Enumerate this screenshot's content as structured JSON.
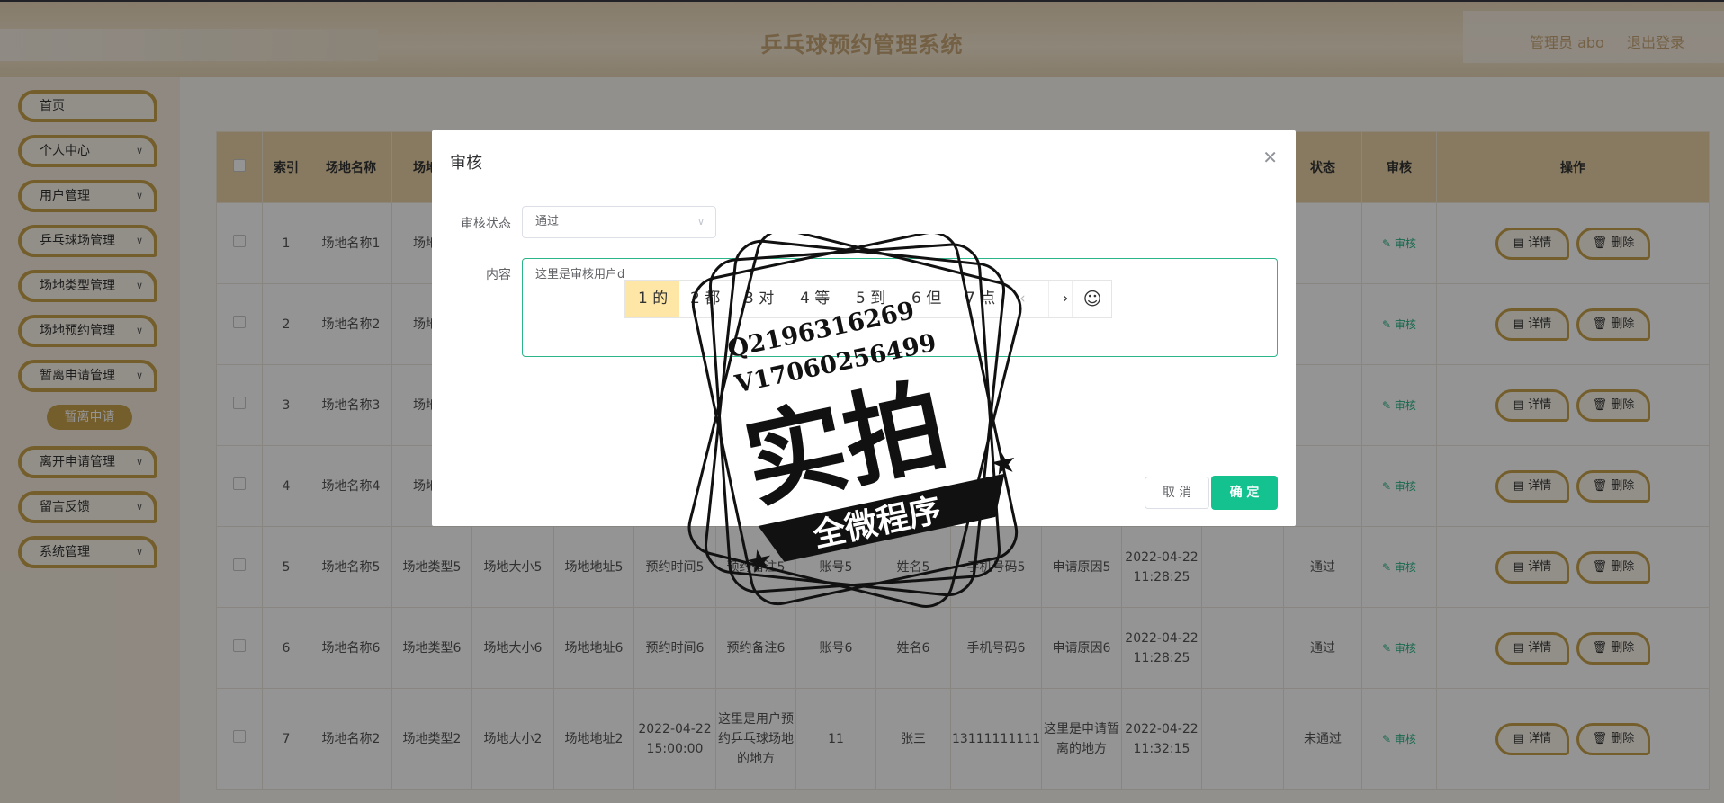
{
  "header": {
    "title": "乒乓球预约管理系统",
    "admin_label": "管理员 abo",
    "logout_label": "退出登录"
  },
  "sidebar": {
    "items": [
      {
        "label": "首页",
        "has_chevron": false
      },
      {
        "label": "个人中心",
        "has_chevron": true
      },
      {
        "label": "用户管理",
        "has_chevron": true
      },
      {
        "label": "乒乓球场管理",
        "has_chevron": true
      },
      {
        "label": "场地类型管理",
        "has_chevron": true
      },
      {
        "label": "场地预约管理",
        "has_chevron": true
      },
      {
        "label": "暂离申请管理",
        "has_chevron": true
      },
      {
        "label": "离开申请管理",
        "has_chevron": true
      },
      {
        "label": "留言反馈",
        "has_chevron": true
      },
      {
        "label": "系统管理",
        "has_chevron": true
      }
    ],
    "sub_item": "暂离申请",
    "chevron_icon": "chevron-down-icon"
  },
  "toolbar": {
    "delete_label": "删除"
  },
  "table": {
    "headers": {
      "index": "索引",
      "venue_name": "场地名称",
      "venue_type": "场地类",
      "status_tail": "状态",
      "audit": "审核",
      "ops": "操作"
    },
    "detail_label": "详情",
    "delete_label": "删除",
    "audit_label": "审核",
    "rows": [
      {
        "idx": "1",
        "name": "场地名称1",
        "type": "场地类",
        "size": "",
        "addr": "",
        "time": "",
        "note": "",
        "acct": "",
        "uname": "",
        "phone": "",
        "reason": "",
        "date": "",
        "result": ""
      },
      {
        "idx": "2",
        "name": "场地名称2",
        "type": "场地类",
        "size": "",
        "addr": "",
        "time": "",
        "note": "",
        "acct": "",
        "uname": "",
        "phone": "",
        "reason": "",
        "date": "",
        "result": ""
      },
      {
        "idx": "3",
        "name": "场地名称3",
        "type": "场地类",
        "size": "",
        "addr": "",
        "time": "",
        "note": "",
        "acct": "",
        "uname": "",
        "phone": "",
        "reason": "",
        "date": "",
        "result": ""
      },
      {
        "idx": "4",
        "name": "场地名称4",
        "type": "场地类",
        "size": "",
        "addr": "",
        "time": "",
        "note": "",
        "acct": "",
        "uname": "",
        "phone": "",
        "reason": "",
        "date": "",
        "result": ""
      },
      {
        "idx": "5",
        "name": "场地名称5",
        "type": "场地类型5",
        "size": "场地大小5",
        "addr": "场地地址5",
        "time": "预约时间5",
        "note": "预约备注5",
        "acct": "账号5",
        "uname": "姓名5",
        "phone": "手机号码5",
        "reason": "申请原因5",
        "date": "2022-04-22 11:28:25",
        "result": "通过"
      },
      {
        "idx": "6",
        "name": "场地名称6",
        "type": "场地类型6",
        "size": "场地大小6",
        "addr": "场地地址6",
        "time": "预约时间6",
        "note": "预约备注6",
        "acct": "账号6",
        "uname": "姓名6",
        "phone": "手机号码6",
        "reason": "申请原因6",
        "date": "2022-04-22 11:28:25",
        "result": "通过"
      },
      {
        "idx": "7",
        "name": "场地名称2",
        "type": "场地类型2",
        "size": "场地大小2",
        "addr": "场地地址2",
        "time": "2022-04-22 15:00:00",
        "note": "这里是用户预约乒乓球场地的地方",
        "acct": "11",
        "uname": "张三",
        "phone": "13111111111",
        "reason": "这里是申请暂离的地方",
        "date": "2022-04-22 11:32:15",
        "result": "未通过"
      }
    ]
  },
  "dialog": {
    "title": "审核",
    "status_label": "审核状态",
    "status_value": "通过",
    "content_label": "内容",
    "content_value": "这里是审核用户d",
    "cancel_label": "取 消",
    "ok_label": "确 定",
    "close_icon": "close-icon"
  },
  "ime": {
    "candidates": [
      "1 的",
      "2 都",
      "3 对",
      "4 等",
      "5 到",
      "6 但",
      "7 点"
    ],
    "prev": "‹",
    "next": "›",
    "emoji": "☺"
  },
  "watermark": {
    "line1": "Q2196316269",
    "line2": "V17060256499",
    "big": "实拍",
    "banner": "全微程序"
  }
}
